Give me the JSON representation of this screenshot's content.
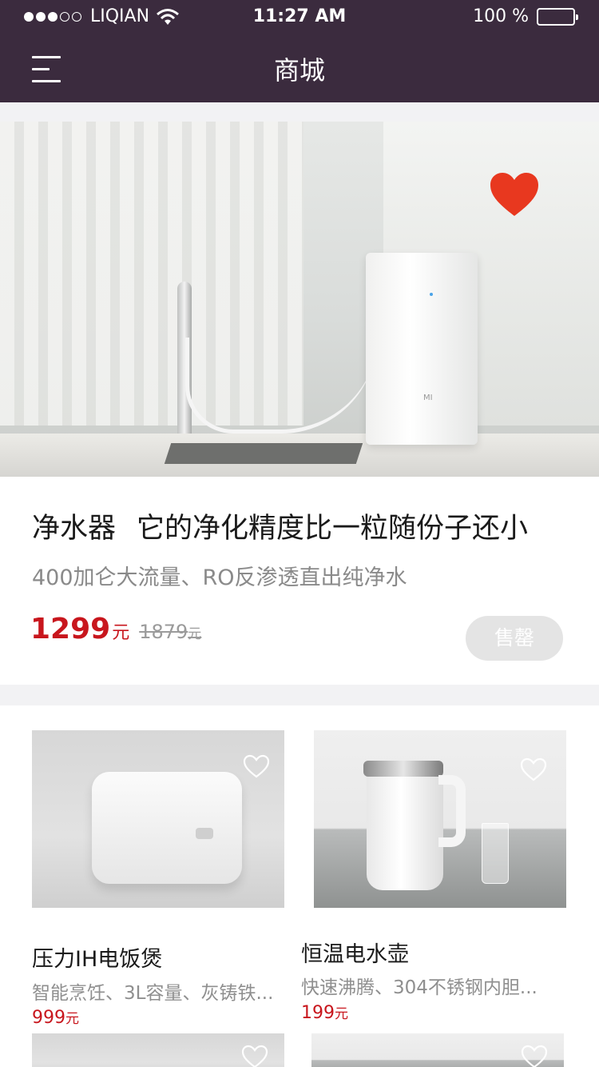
{
  "status_bar": {
    "carrier": "LIQIAN",
    "time": "11:27 AM",
    "battery": "100 %",
    "battery_level": 1.0
  },
  "nav": {
    "title": "商城"
  },
  "featured": {
    "name": "净水器",
    "tagline": "它的净化精度比一粒随份子还小",
    "subtitle": "400加仑大流量、RO反渗透直出纯净水",
    "price": "1299",
    "price_unit": "元",
    "old_price": "1879",
    "old_price_unit": "元",
    "button_label": "售罄",
    "favorited": true,
    "product_brand_mark": "MI"
  },
  "products": [
    {
      "title": "压力IH电饭煲",
      "desc": "智能烹饪、3L容量、灰铸铁...",
      "price": "999",
      "price_unit": "元",
      "favorited": false
    },
    {
      "title": "恒温电水壶",
      "desc": "快速沸腾、304不锈钢内胆...",
      "price": "199",
      "price_unit": "元",
      "favorited": false
    }
  ],
  "colors": {
    "header_bg": "#3b2b3e",
    "price_red": "#c8161d",
    "heart_red": "#e8381f",
    "soldout_bg": "#e4e4e4"
  },
  "icons": {
    "menu": "hamburger-menu-icon",
    "favorite_filled": "heart-filled-icon",
    "favorite_outline": "heart-outline-icon",
    "wifi": "wifi-icon",
    "battery": "battery-icon"
  }
}
